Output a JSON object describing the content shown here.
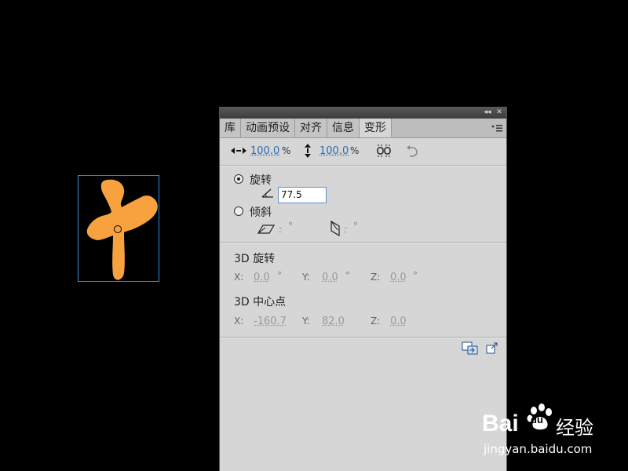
{
  "panel": {
    "tabs": [
      "库",
      "动画预设",
      "对齐",
      "信息",
      "变形"
    ],
    "active_tab": "变形",
    "scale": {
      "width_value": "100.0",
      "height_value": "100.0",
      "unit": "%"
    },
    "rotate": {
      "label": "旋转",
      "value": "77.5",
      "selected": true
    },
    "skew": {
      "label": "倾斜",
      "h_value": "-",
      "v_value": "-",
      "deg": "°"
    },
    "rotation3d": {
      "title": "3D 旋转",
      "x_label": "X:",
      "x_value": "0.0",
      "y_label": "Y:",
      "y_value": "0.0",
      "z_label": "Z:",
      "z_value": "0.0",
      "deg": "°"
    },
    "center3d": {
      "title": "3D 中心点",
      "x_label": "X:",
      "x_value": "-160.7",
      "y_label": "Y:",
      "y_value": "82.0",
      "z_label": "Z:",
      "z_value": "0.0"
    }
  },
  "stage": {
    "glyph_color": "#f7a23e",
    "selection_color": "#2a8fd8"
  },
  "watermark": {
    "logo": "Bai",
    "logo2": "du",
    "brand": "经验",
    "url": "jingyan.baidu.com"
  }
}
